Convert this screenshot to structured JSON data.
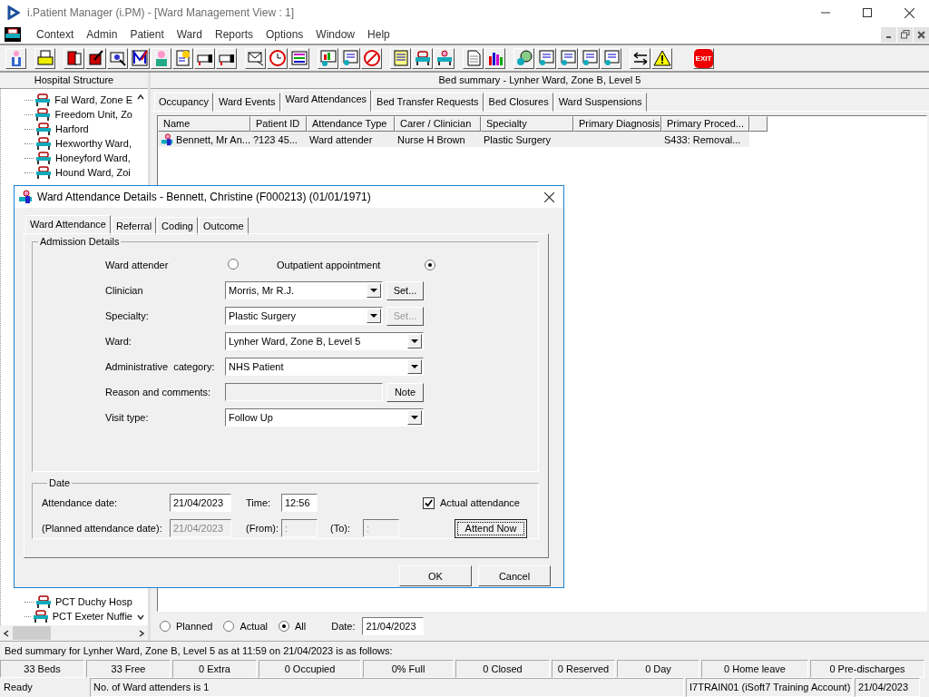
{
  "window": {
    "title": "i.Patient Manager (i.PM) - [Ward Management View : 1]"
  },
  "menu": [
    "Context",
    "Admin",
    "Patient",
    "Ward",
    "Reports",
    "Options",
    "Window",
    "Help"
  ],
  "toolbar": {
    "exit_label": "EXIT"
  },
  "tree": {
    "title": "Hospital Structure",
    "upper_items": [
      "Fal Ward, Zone E",
      "Freedom Unit, Zo",
      "Harford",
      "Hexworthy Ward,",
      "Honeyford Ward,",
      "Hound Ward, Zoi"
    ],
    "lower_items": [
      "PCT Duchy Hosp",
      "PCT Exeter Nuffie"
    ]
  },
  "summary_title": "Bed summary - Lynher Ward, Zone B, Level 5",
  "tabs": [
    {
      "label": "Occupancy",
      "selected": false
    },
    {
      "label": "Ward Events",
      "selected": false
    },
    {
      "label": "Ward Attendances",
      "selected": true
    },
    {
      "label": "Bed Transfer Requests",
      "selected": false
    },
    {
      "label": "Bed Closures",
      "selected": false
    },
    {
      "label": "Ward Suspensions",
      "selected": false
    }
  ],
  "table": {
    "columns": [
      "Name",
      "Patient ID",
      "Attendance Type",
      "Carer / Clinician",
      "Specialty",
      "Primary Diagnosis",
      "Primary Proced..."
    ],
    "rows": [
      {
        "selected": true,
        "cells": [
          "Bennett, Mr An...",
          "?123 45...",
          "Ward attender",
          "Nurse H Brown",
          "Plastic Surgery",
          "",
          "S433: Removal..."
        ]
      }
    ]
  },
  "filter": {
    "options": [
      {
        "label": "Planned",
        "selected": false
      },
      {
        "label": "Actual",
        "selected": false
      },
      {
        "label": "All",
        "selected": true
      }
    ],
    "date_label": "Date:",
    "date": "21/04/2023"
  },
  "dialog": {
    "title": "Ward Attendance Details - Bennett, Christine (F000213) (01/01/1971)",
    "tabs": [
      {
        "label": "Ward Attendance",
        "selected": true
      },
      {
        "label": "Referral",
        "selected": false
      },
      {
        "label": "Coding",
        "selected": false
      },
      {
        "label": "Outcome",
        "selected": false
      }
    ],
    "admission_title": "Admission Details",
    "attendance_type": [
      {
        "label": "Ward attender",
        "selected": false
      },
      {
        "label": "Outpatient appointment",
        "selected": true
      }
    ],
    "fields": [
      {
        "kind": "combo",
        "label": "Clinician",
        "value": "Morris, Mr R.J.",
        "button": {
          "label": "Set...",
          "disabled": false
        }
      },
      {
        "kind": "combo",
        "label": "Specialty:",
        "value": "Plastic Surgery",
        "button": {
          "label": "Set...",
          "disabled": true
        }
      },
      {
        "kind": "combo",
        "label": "Ward:",
        "value": "Lynher Ward, Zone B, Level 5"
      },
      {
        "kind": "combo",
        "label": "Administrative  category:",
        "value": "NHS Patient"
      },
      {
        "kind": "text",
        "label": "Reason and comments:",
        "disabled": true,
        "button": {
          "label": "Note",
          "disabled": false
        }
      },
      {
        "kind": "combo",
        "label": "Visit type:",
        "value": "Follow Up"
      }
    ],
    "date_title": "Date",
    "attendance_date": {
      "label": "Attendance date:",
      "value": "21/04/2023"
    },
    "time": {
      "label": "Time:",
      "value": "12:56"
    },
    "actual_attendance": {
      "label": "Actual attendance",
      "checked": true
    },
    "planned_date": {
      "label": "(Planned attendance date):",
      "value": "21/04/2023",
      "disabled": true
    },
    "from": {
      "label": "(From):",
      "value": ":",
      "disabled": true
    },
    "to": {
      "label": "(To):",
      "value": ":",
      "disabled": true
    },
    "attend_now": "Attend Now",
    "buttons": [
      "OK",
      "Cancel"
    ]
  },
  "status": {
    "message": "Bed summary for Lynher Ward, Zone B, Level 5 as at 11:59 on 21/04/2023 is as follows:",
    "counts": [
      "33 Beds",
      "33 Free",
      "0 Extra",
      "0 Occupied",
      "0% Full",
      "0 Closed",
      "0 Reserved",
      "0 Day",
      "0 Home leave",
      "0 Pre-discharges"
    ],
    "panels": [
      "Ready",
      "No. of Ward attenders is 1",
      "I7TRAIN01 (iSoft7 Training Account)",
      "21/04/2023"
    ]
  }
}
